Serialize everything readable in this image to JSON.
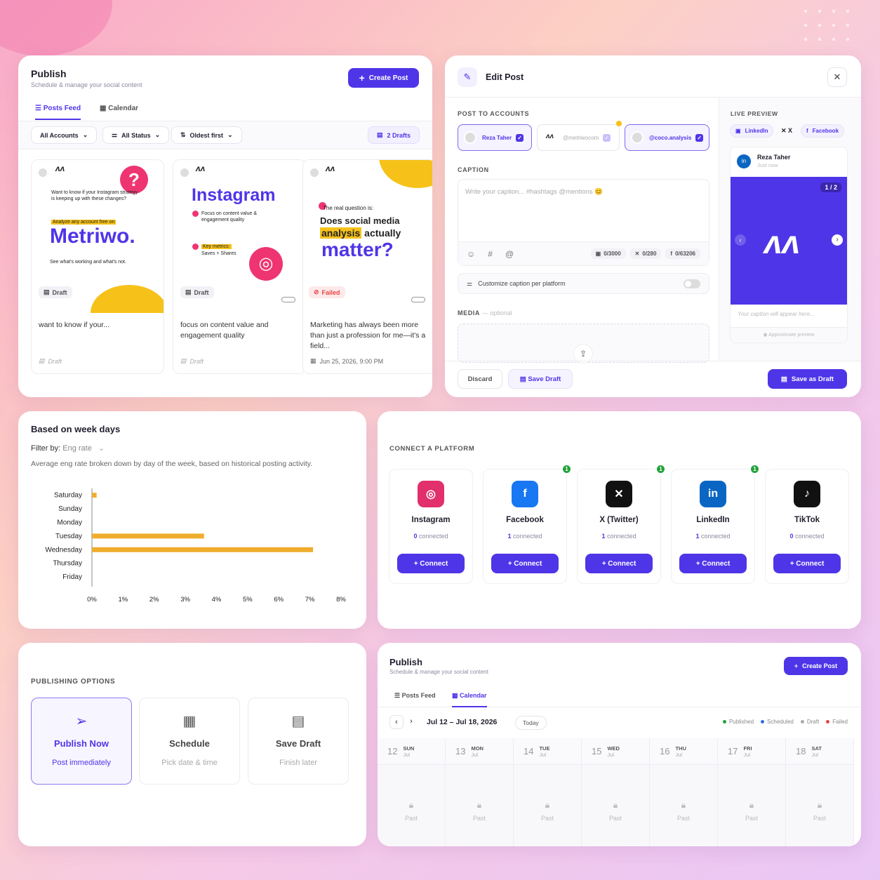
{
  "publish": {
    "title": "Publish",
    "subtitle": "Schedule & manage your social content",
    "create_btn": "Create Post",
    "tabs": [
      "Posts Feed",
      "Calendar"
    ],
    "filters": [
      "All Accounts",
      "All Status",
      "Oldest first"
    ],
    "drafts": "2 Drafts",
    "posts": [
      {
        "status": "Draft",
        "caption": "want to know if your...",
        "footer": "Draft",
        "img": {
          "line1": "Want to know if your Instagram strategy is keeping up with these changes?",
          "highlight": "Analyze any account free on",
          "brand": "Metriwo.",
          "line3": "See what's working and what's not."
        }
      },
      {
        "status": "Draft",
        "caption": "focus on content value and engagement quality",
        "footer": "Draft",
        "img": {
          "brand": "Instagram",
          "point1": "Focus on content value & engagement quality",
          "point2_hl": "Key metrics:",
          "point2": "Saves + Shares"
        }
      },
      {
        "status": "Failed",
        "caption": "Marketing has always been more than just a profession for me—it's a field...",
        "footer": "Jun 25, 2026, 9:00 PM",
        "img": {
          "line1": "The real question is:",
          "line2": "Does social media",
          "line3_hl": "analysis",
          "line3": "actually",
          "brand": "matter?"
        }
      }
    ]
  },
  "edit": {
    "title": "Edit Post",
    "post_to": "POST TO ACCOUNTS",
    "accounts": [
      "Reza Taher",
      "@metriwocom",
      "@coco.analysis"
    ],
    "caption_label": "CAPTION",
    "caption_placeholder": "Write your caption... #hashtags @mentions 😊",
    "counters": [
      "0/3000",
      "0/280",
      "0/63206"
    ],
    "customize": "Customize caption per platform",
    "media_label": "MEDIA",
    "media_optional": "— optional",
    "discard": "Discard",
    "save_draft": "Save Draft",
    "save_as_draft": "Save as Draft",
    "preview": {
      "label": "LIVE PREVIEW",
      "tabs": [
        "LinkedIn",
        "X",
        "Facebook"
      ],
      "name": "Reza Taher",
      "time": "Just now",
      "pager": "1 / 2",
      "caption": "Your caption will appear here...",
      "approx": "Approximate preview"
    }
  },
  "chart_card": {
    "title": "Based on week days",
    "filter_label": "Filter by:",
    "filter_value": "Eng rate",
    "description": "Average eng rate broken down by day of the week, based on historical posting activity."
  },
  "chart_data": {
    "type": "bar",
    "orientation": "horizontal",
    "categories": [
      "Saturday",
      "Sunday",
      "Monday",
      "Tuesday",
      "Wednesday",
      "Thursday",
      "Friday"
    ],
    "values": [
      0.15,
      0,
      0,
      3.6,
      7.1,
      0,
      0
    ],
    "xlim": [
      0,
      8
    ],
    "xticks": [
      "0%",
      "1%",
      "2%",
      "3%",
      "4%",
      "5%",
      "6%",
      "7%",
      "8%"
    ],
    "color": "#f0ad2d",
    "grid": false
  },
  "connect": {
    "title": "CONNECT A PLATFORM",
    "platforms": [
      {
        "name": "Instagram",
        "count": "0",
        "suffix": "connected",
        "btn": "+ Connect",
        "badge": "",
        "color": "#e1306c",
        "glyph": "◎"
      },
      {
        "name": "Facebook",
        "count": "1",
        "suffix": "connected",
        "btn": "+ Connect",
        "badge": "1",
        "color": "#1877f2",
        "glyph": "f"
      },
      {
        "name": "X (Twitter)",
        "count": "1",
        "suffix": "connected",
        "btn": "+ Connect",
        "badge": "1",
        "color": "#111111",
        "glyph": "✕"
      },
      {
        "name": "LinkedIn",
        "count": "1",
        "suffix": "connected",
        "btn": "+ Connect",
        "badge": "1",
        "color": "#0a66c2",
        "glyph": "in"
      },
      {
        "name": "TikTok",
        "count": "0",
        "suffix": "connected",
        "btn": "+ Connect",
        "badge": "",
        "color": "#111111",
        "glyph": "♪"
      }
    ]
  },
  "options": {
    "title": "PUBLISHING OPTIONS",
    "items": [
      {
        "title": "Publish Now",
        "sub": "Post immediately"
      },
      {
        "title": "Schedule",
        "sub": "Pick date & time"
      },
      {
        "title": "Save Draft",
        "sub": "Finish later"
      }
    ]
  },
  "calendar": {
    "title": "Publish",
    "subtitle": "Schedule & manage your social content",
    "create_btn": "Create Post",
    "tabs": [
      "Posts Feed",
      "Calendar"
    ],
    "range": "Jul 12 – Jul 18, 2026",
    "today": "Today",
    "legend": [
      {
        "label": "Published",
        "color": "#22a33a"
      },
      {
        "label": "Scheduled",
        "color": "#2f6fe8"
      },
      {
        "label": "Draft",
        "color": "#aaaaaa"
      },
      {
        "label": "Failed",
        "color": "#e54545"
      }
    ],
    "days": [
      {
        "num": "12",
        "wd": "SUN",
        "mo": "Jul",
        "past": "Past"
      },
      {
        "num": "13",
        "wd": "MON",
        "mo": "Jul",
        "past": "Past"
      },
      {
        "num": "14",
        "wd": "TUE",
        "mo": "Jul",
        "past": "Past"
      },
      {
        "num": "15",
        "wd": "WED",
        "mo": "Jul",
        "past": "Past"
      },
      {
        "num": "16",
        "wd": "THU",
        "mo": "Jul",
        "past": "Past"
      },
      {
        "num": "17",
        "wd": "FRI",
        "mo": "Jul",
        "past": "Past"
      },
      {
        "num": "18",
        "wd": "SAT",
        "mo": "Jul",
        "past": "Past"
      }
    ]
  }
}
